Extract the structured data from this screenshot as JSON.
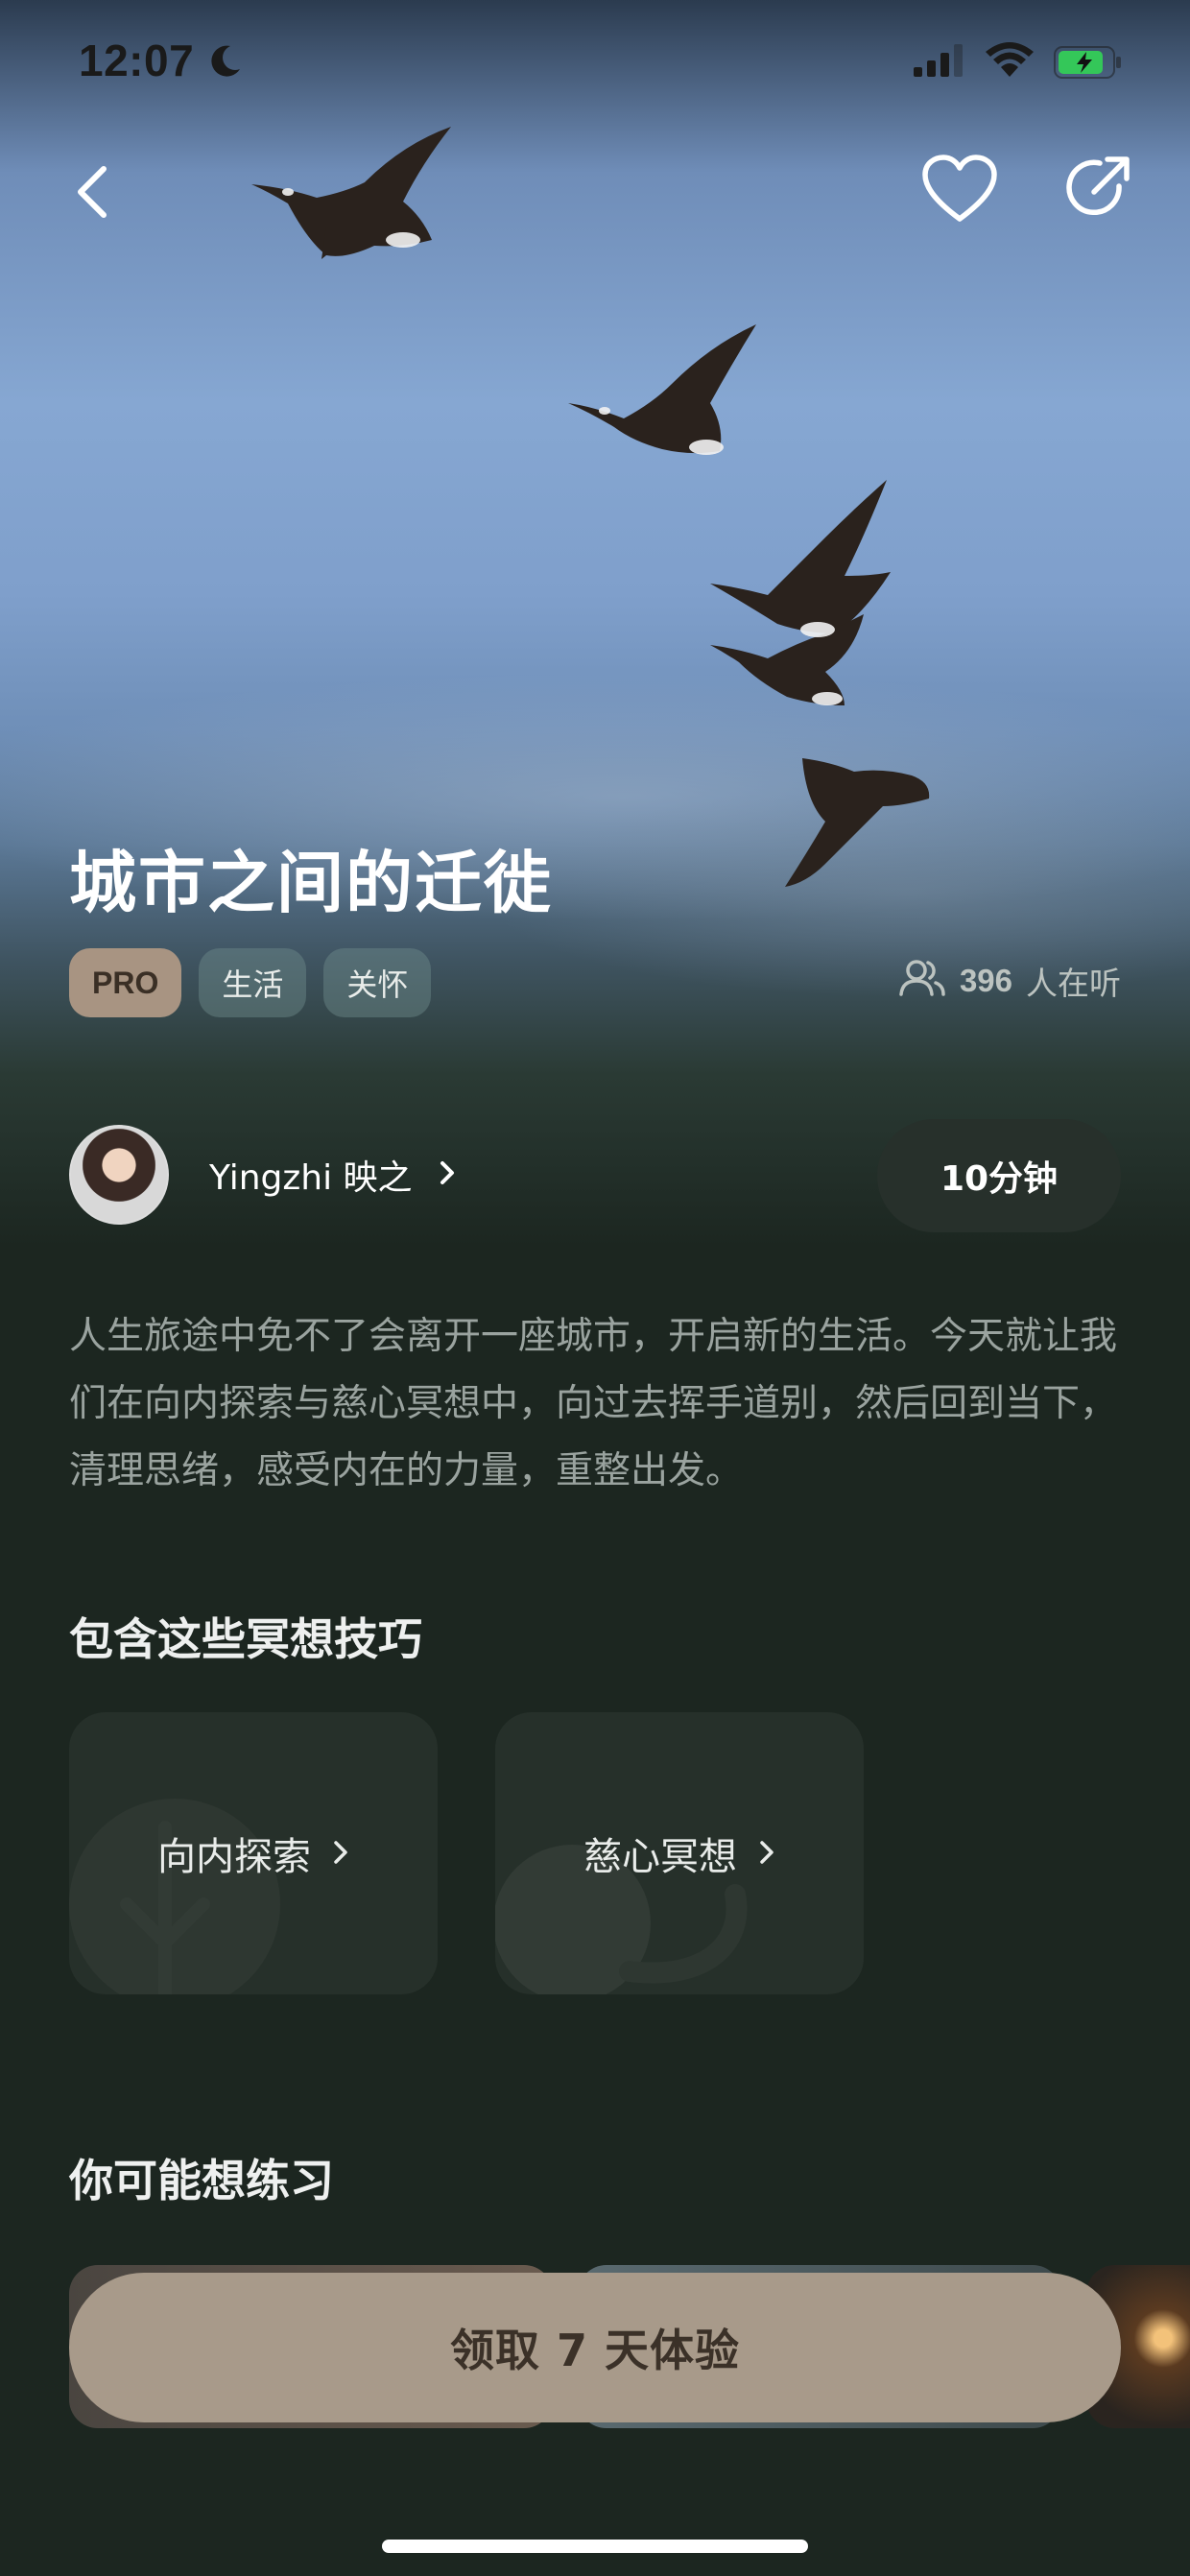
{
  "status_bar": {
    "time": "12:07",
    "icons": [
      "moon-icon",
      "cellular-signal-icon",
      "wifi-icon",
      "battery-charging-icon"
    ]
  },
  "nav": {
    "icons": [
      "back-chevron-icon",
      "heart-icon",
      "share-icon"
    ]
  },
  "hero": {
    "title": "城市之间的迁徙",
    "tags": [
      {
        "label": "PRO",
        "kind": "pro"
      },
      {
        "label": "生活",
        "kind": "category"
      },
      {
        "label": "关怀",
        "kind": "category"
      }
    ],
    "listeners_count": "396",
    "listeners_suffix": "人在听"
  },
  "author": {
    "name": "Yingzhi 映之"
  },
  "duration_label": "10分钟",
  "description": "人生旅途中免不了会离开一座城市，开启新的生活。今天就让我们在向内探索与慈心冥想中，向过去挥手道别，然后回到当下，清理思绪，感受内在的力量，重整出发。",
  "techniques": {
    "section_title": "包含这些冥想技巧",
    "items": [
      {
        "label": "向内探索"
      },
      {
        "label": "慈心冥想"
      }
    ]
  },
  "recommendations": {
    "section_title": "你可能想练习"
  },
  "cta": {
    "label": "领取 7 天体验"
  },
  "colors": {
    "background": "#1c2620",
    "pro_tag": "#a89482",
    "cta": "#a89a8a",
    "card": "#26302a"
  }
}
